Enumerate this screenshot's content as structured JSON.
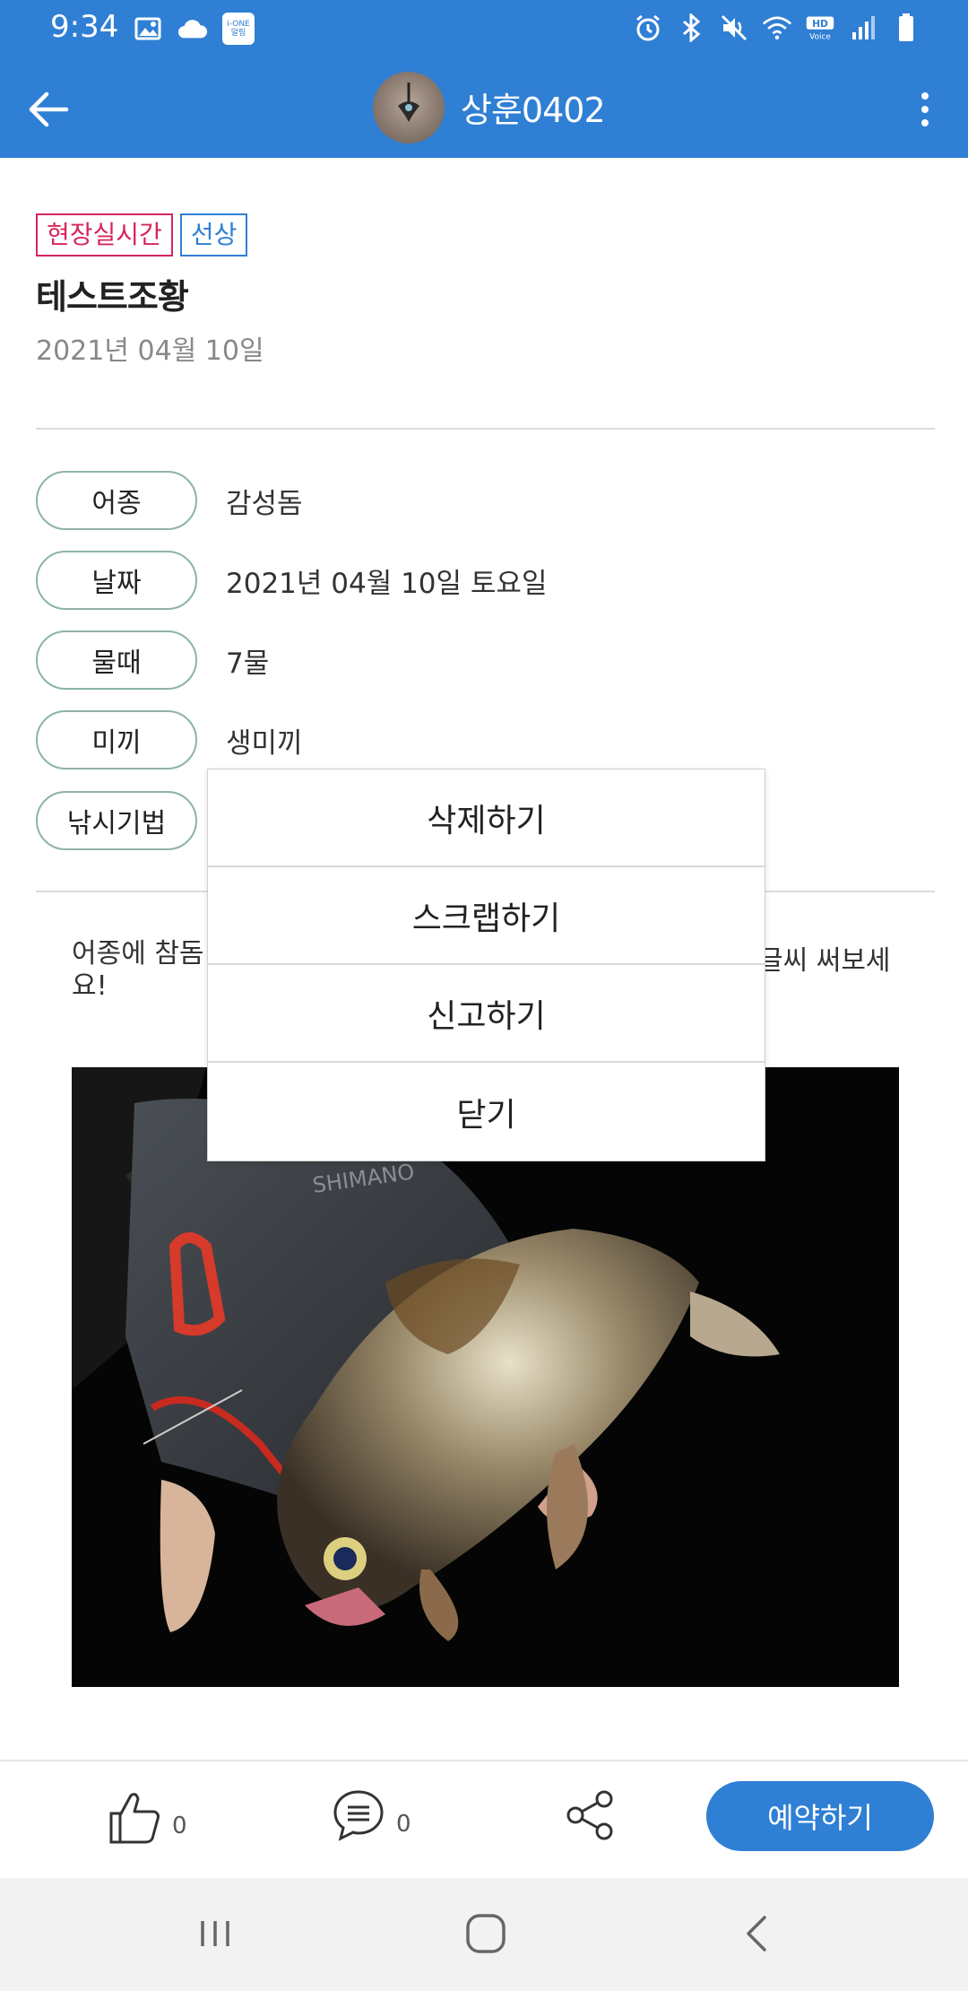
{
  "status_bar": {
    "time": "9:34",
    "left_icons": [
      "image-icon",
      "cloud-icon",
      "ione-app-icon"
    ],
    "ione_badge": [
      "i-ONE",
      "알림"
    ],
    "right_icons": [
      "alarm-icon",
      "bluetooth-icon",
      "mute-icon",
      "wifi-icon",
      "hd-voice-icon",
      "signal-icon",
      "battery-icon"
    ]
  },
  "app_bar": {
    "title": "상훈0402",
    "background": "#2f7fd4"
  },
  "post": {
    "tags": [
      "현장실시간",
      "선상"
    ],
    "title": "테스트조황",
    "date": "2021년 04월 10일"
  },
  "info": [
    {
      "label": "어종",
      "value": "감성돔"
    },
    {
      "label": "날짜",
      "value": "2021년 04월 10일 토요일"
    },
    {
      "label": "물때",
      "value": "7물"
    },
    {
      "label": "미끼",
      "value": "생미끼"
    },
    {
      "label": "낚시기법",
      "value": ""
    }
  ],
  "description": {
    "start": "어종에 참돔",
    "end": "글씨 써보세",
    "line2": "요!"
  },
  "menu": {
    "items": [
      "삭제하기",
      "스크랩하기",
      "신고하기",
      "닫기"
    ]
  },
  "actions": {
    "like_count": "0",
    "comment_count": "0",
    "reserve_label": "예약하기"
  },
  "colors": {
    "primary": "#2f7fd4",
    "tag_live": "#d6265b",
    "pill_border": "#8db4a3"
  }
}
